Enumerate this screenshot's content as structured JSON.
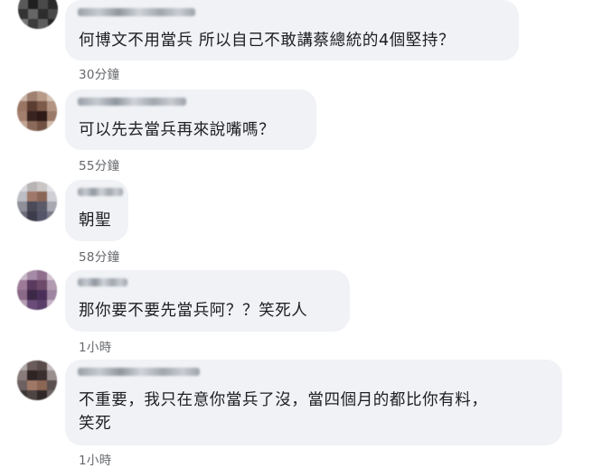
{
  "comments": [
    {
      "text": "何博文不用當兵 所以自己不敢講蔡總統的4個堅持？",
      "time": "30分鐘"
    },
    {
      "text": "可以先去當兵再來說嘴嗎？",
      "time": "55分鐘"
    },
    {
      "text": "朝聖",
      "time": "58分鐘"
    },
    {
      "text": "那你要不要先當兵阿？？笑死人",
      "time": "1小時"
    },
    {
      "text": "不重要，我只在意你當兵了沒，當四個月的都比你有料，\n笑死",
      "time": "1小時"
    }
  ]
}
